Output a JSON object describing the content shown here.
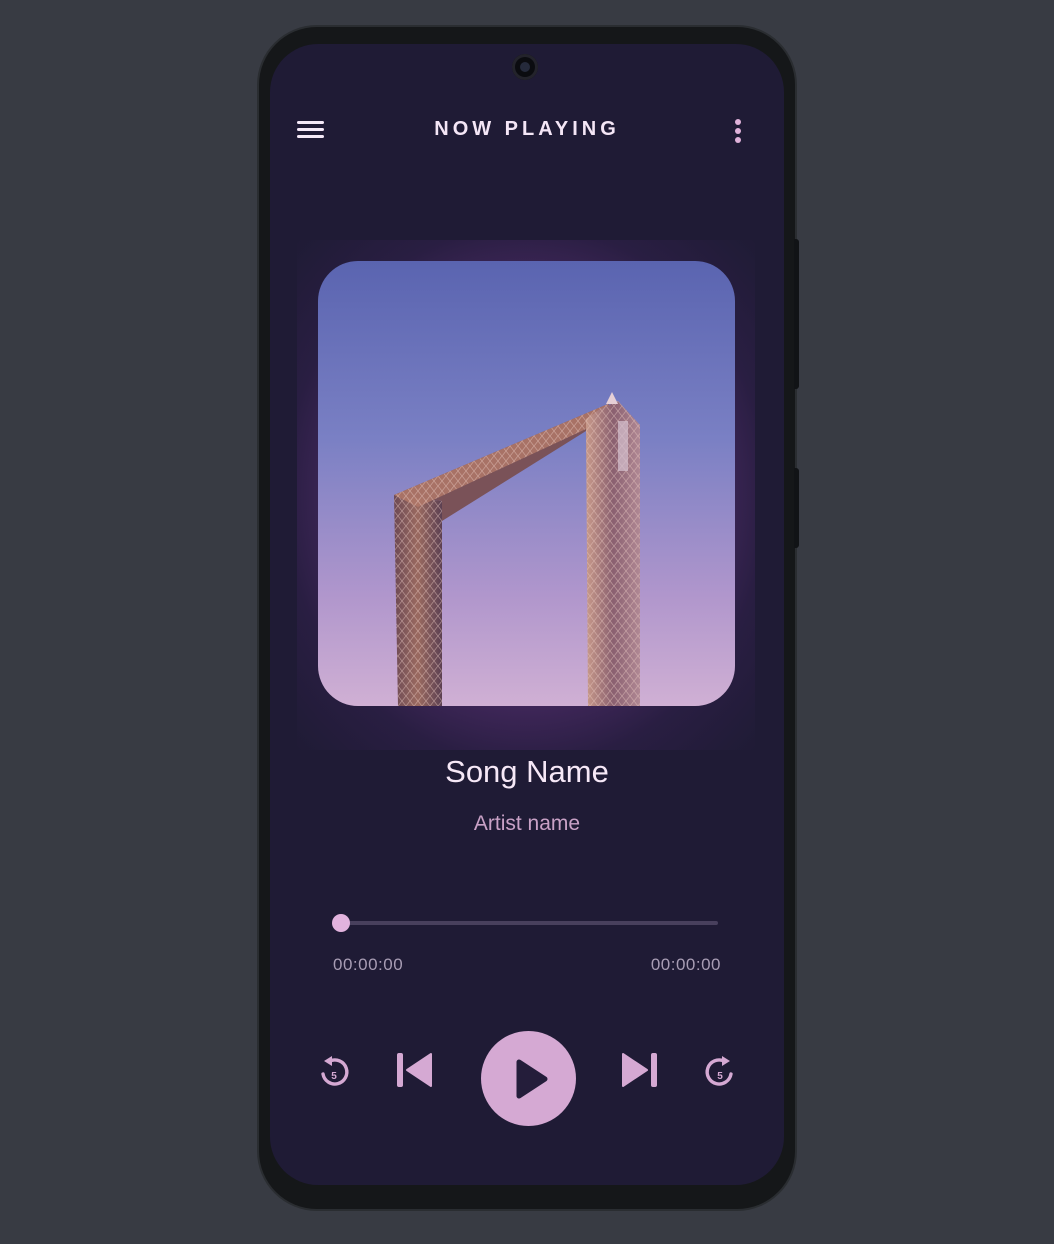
{
  "header": {
    "title": "NOW PLAYING",
    "menu_icon": "hamburger-menu-icon",
    "more_icon": "more-vertical-icon"
  },
  "track": {
    "song_name": "Song Name",
    "artist_name": "Artist name",
    "album_art": "dubai-frame-building-photo"
  },
  "progress": {
    "current_time": "00:00:00",
    "total_time": "00:00:00",
    "fraction": 0.0
  },
  "controls": {
    "replay_5_icon": "replay-5-icon",
    "replay_5_label": "5",
    "previous_icon": "skip-previous-icon",
    "play_icon": "play-icon",
    "next_icon": "skip-next-icon",
    "forward_5_icon": "forward-5-icon",
    "forward_5_label": "5"
  },
  "colors": {
    "background": "#1f1b35",
    "accent": "#d5a9d3",
    "title_text": "#f4e6f6",
    "secondary_text": "#c9a1c6"
  }
}
